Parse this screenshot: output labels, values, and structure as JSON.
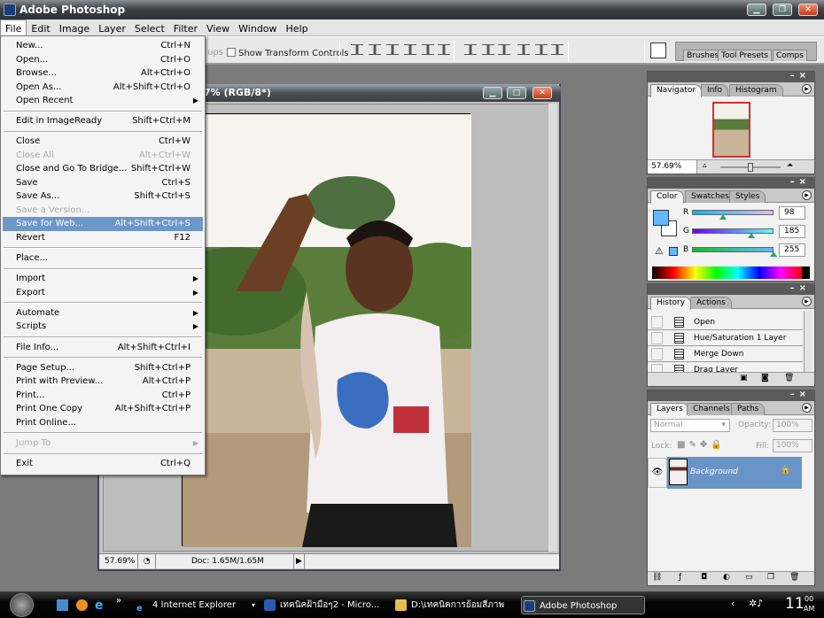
{
  "app": {
    "title": "Adobe Photoshop",
    "window_buttons": [
      "minimize",
      "restore",
      "close"
    ]
  },
  "menubar": [
    "File",
    "Edit",
    "Image",
    "Layer",
    "Select",
    "Filter",
    "View",
    "Window",
    "Help"
  ],
  "options_bar": {
    "partial_label": "ups",
    "show_transform_controls": "Show Transform Controls",
    "show_transform_checked": false
  },
  "palette_well": {
    "tabs": [
      "Brushes",
      "Tool Presets",
      "Comps"
    ]
  },
  "file_menu": [
    {
      "label": "New...",
      "shortcut": "Ctrl+N"
    },
    {
      "label": "Open...",
      "shortcut": "Ctrl+O"
    },
    {
      "label": "Browse...",
      "shortcut": "Alt+Ctrl+O"
    },
    {
      "label": "Open As...",
      "shortcut": "Alt+Shift+Ctrl+O"
    },
    {
      "label": "Open Recent",
      "submenu": true
    },
    {
      "separator": true
    },
    {
      "label": "Edit in ImageReady",
      "shortcut": "Shift+Ctrl+M"
    },
    {
      "separator": true
    },
    {
      "label": "Close",
      "shortcut": "Ctrl+W"
    },
    {
      "label": "Close All",
      "shortcut": "Alt+Ctrl+W",
      "disabled": true
    },
    {
      "label": "Close and Go To Bridge...",
      "shortcut": "Shift+Ctrl+W"
    },
    {
      "label": "Save",
      "shortcut": "Ctrl+S"
    },
    {
      "label": "Save As...",
      "shortcut": "Shift+Ctrl+S"
    },
    {
      "label": "Save a Version...",
      "disabled": true
    },
    {
      "label": "Save for Web...",
      "shortcut": "Alt+Shift+Ctrl+S",
      "highlighted": true
    },
    {
      "label": "Revert",
      "shortcut": "F12"
    },
    {
      "separator": true
    },
    {
      "label": "Place..."
    },
    {
      "separator": true
    },
    {
      "label": "Import",
      "submenu": true
    },
    {
      "label": "Export",
      "submenu": true
    },
    {
      "separator": true
    },
    {
      "label": "Automate",
      "submenu": true
    },
    {
      "label": "Scripts",
      "submenu": true
    },
    {
      "separator": true
    },
    {
      "label": "File Info...",
      "shortcut": "Alt+Shift+Ctrl+I"
    },
    {
      "separator": true
    },
    {
      "label": "Page Setup...",
      "shortcut": "Shift+Ctrl+P"
    },
    {
      "label": "Print with Preview...",
      "shortcut": "Alt+Ctrl+P"
    },
    {
      "label": "Print...",
      "shortcut": "Ctrl+P"
    },
    {
      "label": "Print One Copy",
      "shortcut": "Alt+Shift+Ctrl+P"
    },
    {
      "label": "Print Online..."
    },
    {
      "separator": true
    },
    {
      "label": "Jump To",
      "submenu": true,
      "disabled": true
    },
    {
      "separator": true
    },
    {
      "label": "Exit",
      "shortcut": "Ctrl+Q"
    }
  ],
  "document": {
    "title_visible": "7% (RGB/8*)",
    "zoom": "57.69%",
    "doc_size": "Doc: 1.65M/1.65M"
  },
  "navigator": {
    "tabs": [
      "Navigator",
      "Info",
      "Histogram"
    ],
    "zoom": "57.69%",
    "zoom_slider_fraction": 0.45
  },
  "color": {
    "tabs": [
      "Color",
      "Swatches",
      "Styles"
    ],
    "foreground": "#62B9FF",
    "channels": [
      {
        "label": "R",
        "value": "98"
      },
      {
        "label": "G",
        "value": "185"
      },
      {
        "label": "B",
        "value": "255"
      }
    ]
  },
  "history": {
    "tabs": [
      "History",
      "Actions"
    ],
    "items": [
      "Open",
      "Hue/Saturation 1 Layer",
      "Merge Down",
      "Drag Layer"
    ]
  },
  "layers": {
    "tabs": [
      "Layers",
      "Channels",
      "Paths"
    ],
    "blend_mode": "Normal",
    "opacity_label": "Opacity:",
    "opacity": "100%",
    "lock_label": "Lock:",
    "fill_label": "Fill:",
    "fill": "100%",
    "items": [
      {
        "name": "Background",
        "visible": true,
        "locked": true,
        "selected": true
      }
    ]
  },
  "taskbar": {
    "items": [
      "4 Internet Explorer",
      "เทคนิคฝ้ามือๆ2 - Micro...",
      "D:\\เทคนิคการย้อมสีภาพ",
      "Adobe Photoshop"
    ],
    "overflow": "»",
    "clock": "11",
    "clock_min": "00",
    "clock_ampm": "AM"
  }
}
